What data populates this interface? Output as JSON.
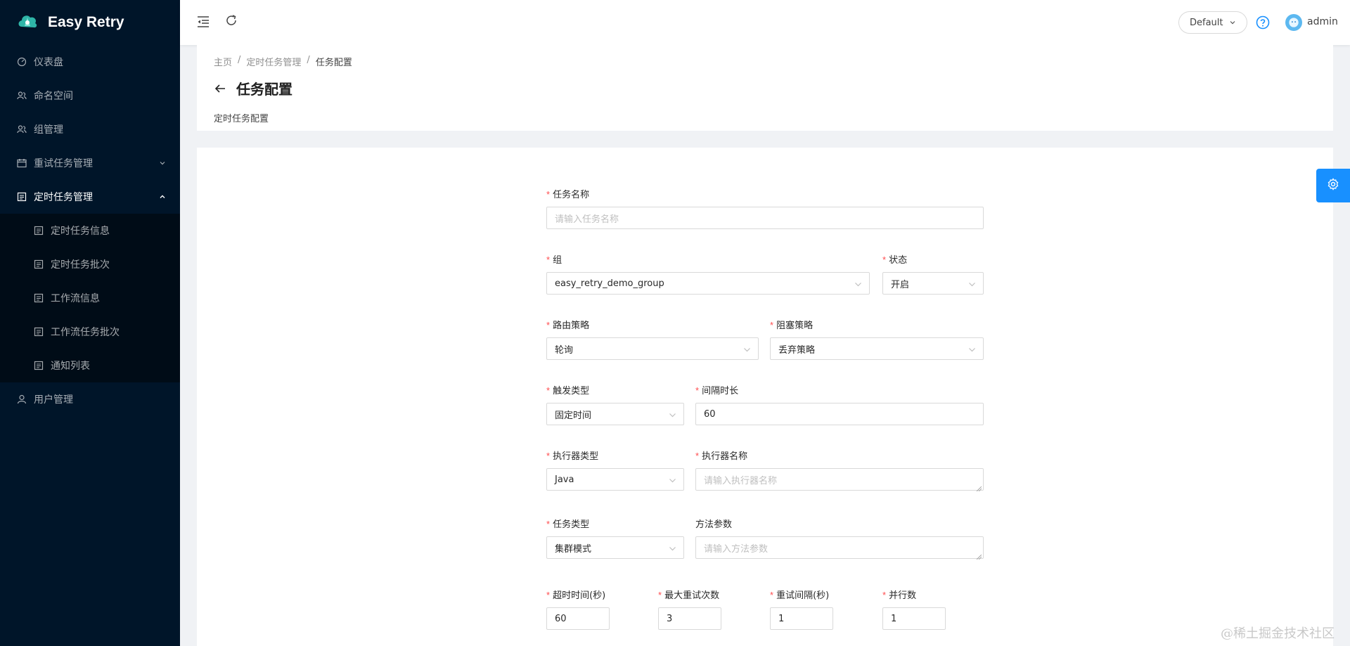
{
  "app": {
    "name": "Easy Retry"
  },
  "sidebar": {
    "items": [
      {
        "label": "仪表盘",
        "icon": "dashboard-icon"
      },
      {
        "label": "命名空间",
        "icon": "team-icon"
      },
      {
        "label": "组管理",
        "icon": "team-icon"
      },
      {
        "label": "重试任务管理",
        "icon": "schedule-icon",
        "expanded": false
      },
      {
        "label": "定时任务管理",
        "icon": "profile-icon",
        "expanded": true
      },
      {
        "label": "用户管理",
        "icon": "user-icon"
      }
    ],
    "sub_items": [
      {
        "label": "定时任务信息"
      },
      {
        "label": "定时任务批次"
      },
      {
        "label": "工作流信息"
      },
      {
        "label": "工作流任务批次"
      },
      {
        "label": "通知列表"
      }
    ]
  },
  "header": {
    "theme_select": "Default",
    "username": "admin"
  },
  "page": {
    "breadcrumb": [
      "主页",
      "定时任务管理",
      "任务配置"
    ],
    "title": "任务配置",
    "description": "定时任务配置"
  },
  "form": {
    "task_name": {
      "label": "任务名称",
      "placeholder": "请输入任务名称",
      "required": true
    },
    "group": {
      "label": "组",
      "value": "easy_retry_demo_group",
      "required": true
    },
    "status": {
      "label": "状态",
      "value": "开启",
      "required": true
    },
    "route_strategy": {
      "label": "路由策略",
      "value": "轮询",
      "required": true
    },
    "block_strategy": {
      "label": "阻塞策略",
      "value": "丢弃策略",
      "required": true
    },
    "trigger_type": {
      "label": "触发类型",
      "value": "固定时间",
      "required": true
    },
    "interval": {
      "label": "间隔时长",
      "value": "60",
      "required": true
    },
    "executor_type": {
      "label": "执行器类型",
      "value": "Java",
      "required": true
    },
    "executor_name": {
      "label": "执行器名称",
      "placeholder": "请输入执行器名称",
      "required": true
    },
    "task_type": {
      "label": "任务类型",
      "value": "集群模式",
      "required": true
    },
    "method_params": {
      "label": "方法参数",
      "placeholder": "请输入方法参数",
      "required": false
    },
    "timeout": {
      "label": "超时时间(秒)",
      "value": "60",
      "required": true
    },
    "max_retry": {
      "label": "最大重试次数",
      "value": "3",
      "required": true
    },
    "retry_interval": {
      "label": "重试间隔(秒)",
      "value": "1",
      "required": true
    },
    "parallel": {
      "label": "并行数",
      "value": "1",
      "required": true
    }
  },
  "watermark": "@稀土掘金技术社区",
  "colors": {
    "sider_bg": "#001529",
    "primary": "#1890ff",
    "required": "#ff4d4f"
  }
}
